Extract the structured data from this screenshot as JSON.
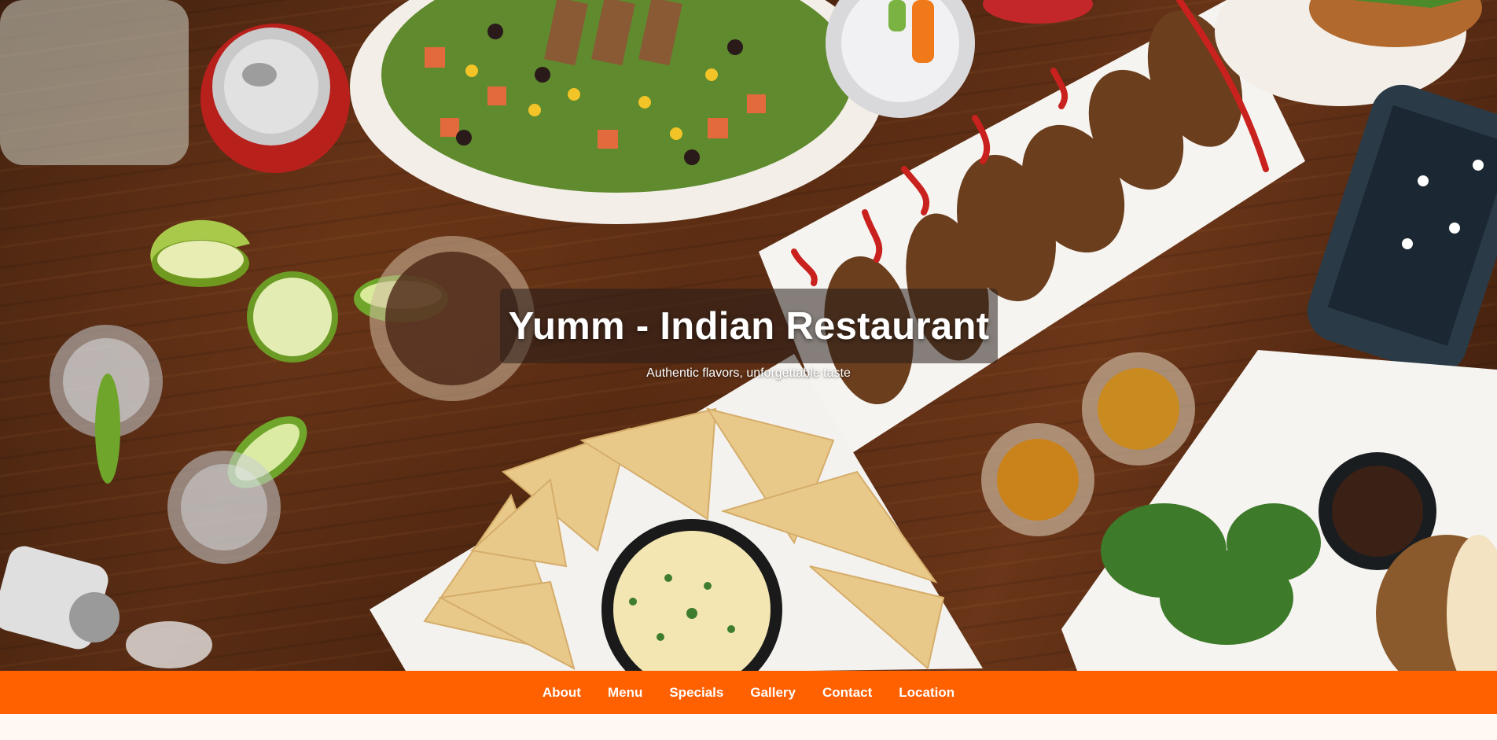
{
  "hero": {
    "title": "Yumm - Indian Restaurant",
    "subtitle": "Authentic flavors, unforgettable taste",
    "image": "food-table-photo"
  },
  "nav": {
    "items": [
      {
        "label": "About"
      },
      {
        "label": "Menu"
      },
      {
        "label": "Specials"
      },
      {
        "label": "Gallery"
      },
      {
        "label": "Contact"
      },
      {
        "label": "Location"
      }
    ]
  },
  "colors": {
    "nav_bg": "#ff6000",
    "nav_text": "#ffffff",
    "title_text": "#ffffff",
    "page_bg": "#fff8f3"
  }
}
